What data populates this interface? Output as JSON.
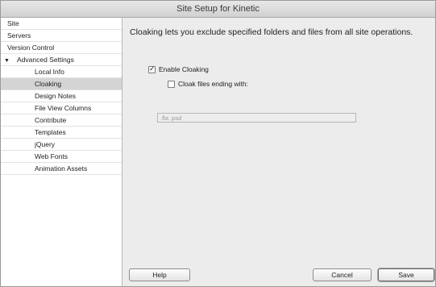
{
  "window": {
    "title": "Site Setup for Kinetic"
  },
  "sidebar": {
    "items": [
      {
        "label": "Site"
      },
      {
        "label": "Servers"
      },
      {
        "label": "Version Control"
      },
      {
        "label": "Advanced Settings"
      },
      {
        "label": "Local Info"
      },
      {
        "label": "Cloaking"
      },
      {
        "label": "Design Notes"
      },
      {
        "label": "File View Columns"
      },
      {
        "label": "Contribute"
      },
      {
        "label": "Templates"
      },
      {
        "label": "jQuery"
      },
      {
        "label": "Web Fonts"
      },
      {
        "label": "Animation Assets"
      }
    ],
    "expand_arrow": "▼"
  },
  "main": {
    "description": "Cloaking lets you exclude specified folders and files from all site operations.",
    "enable_cloaking": {
      "label": "Enable Cloaking",
      "checked": true
    },
    "cloak_files": {
      "label": "Cloak files ending with:",
      "checked": false
    },
    "extensions_value": ".fla .psd"
  },
  "buttons": {
    "help": "Help",
    "cancel": "Cancel",
    "save": "Save"
  }
}
